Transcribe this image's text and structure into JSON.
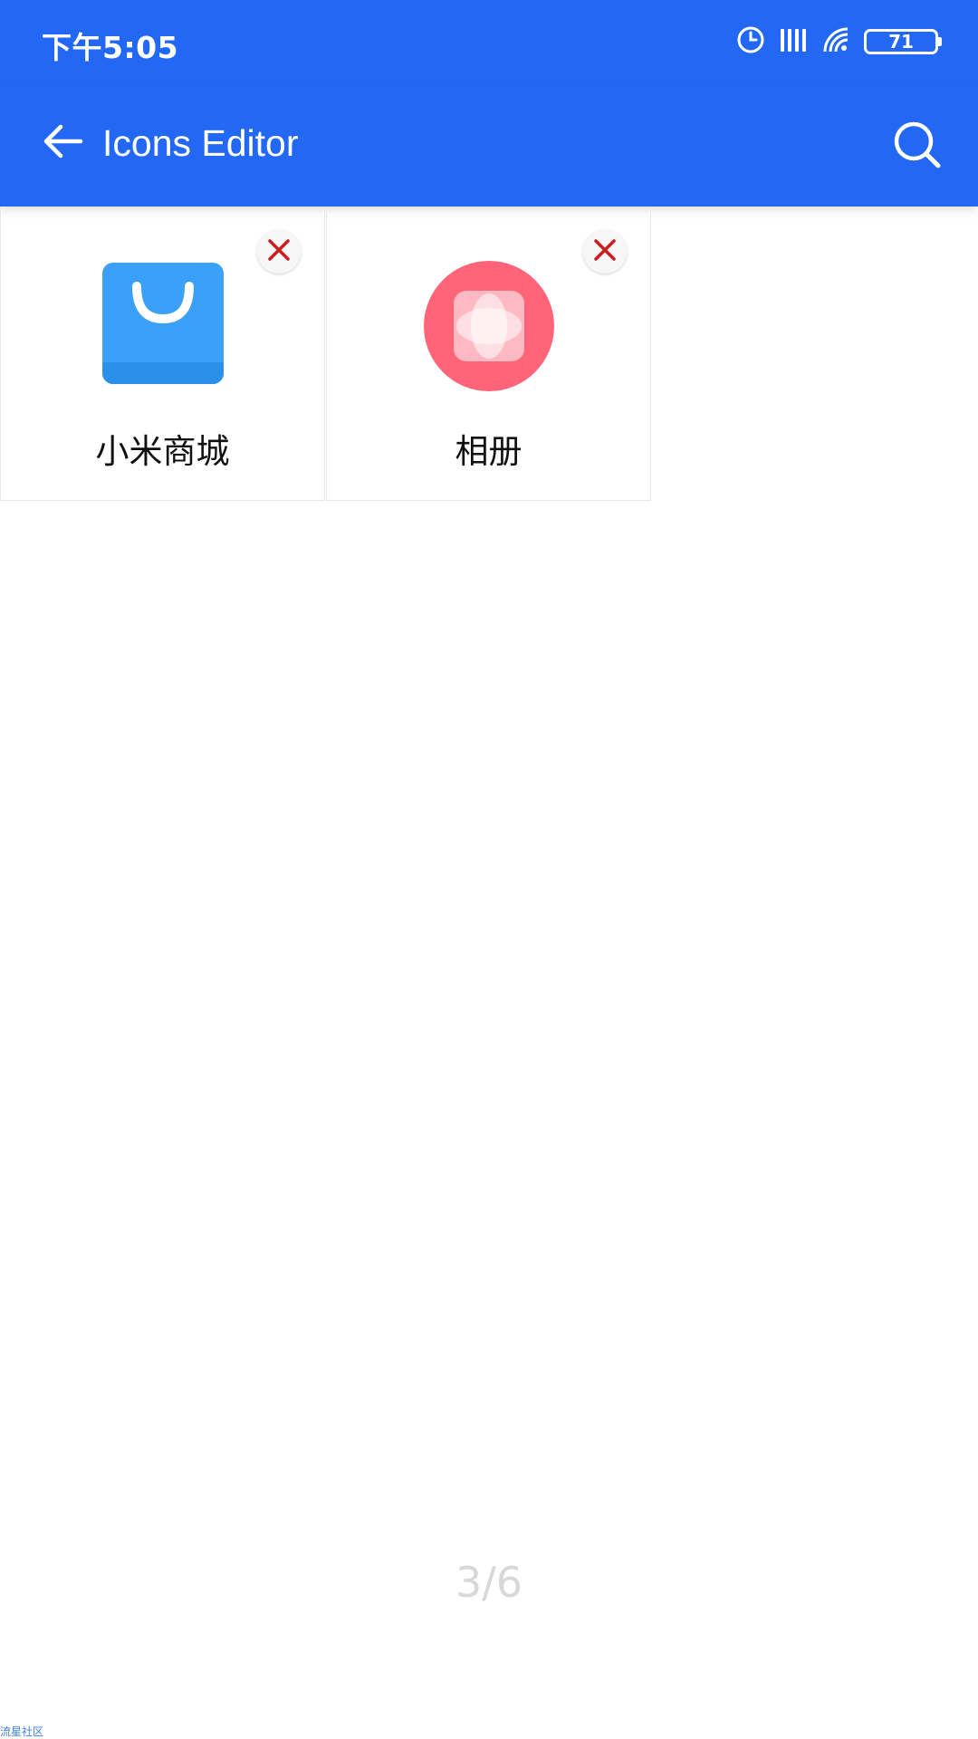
{
  "colors": {
    "app_bar": "#2268f5",
    "remove_x": "#cc1c24",
    "store_icon": "#3ba0f8",
    "gallery_icon": "#ff6478"
  },
  "status_bar": {
    "time": "下午5:05",
    "battery": "71",
    "icons": [
      "alarm-icon",
      "signal-icon",
      "wifi-icon",
      "battery-icon"
    ]
  },
  "app_bar": {
    "title": "Icons Editor",
    "back_icon": "arrow-left-icon",
    "search_icon": "search-icon"
  },
  "icons": [
    {
      "label": "小米商城",
      "icon": "shopping-bag-icon"
    },
    {
      "label": "相册",
      "icon": "gallery-flower-icon"
    }
  ],
  "pagination": {
    "text": "3/6"
  },
  "watermark": "流星社区"
}
